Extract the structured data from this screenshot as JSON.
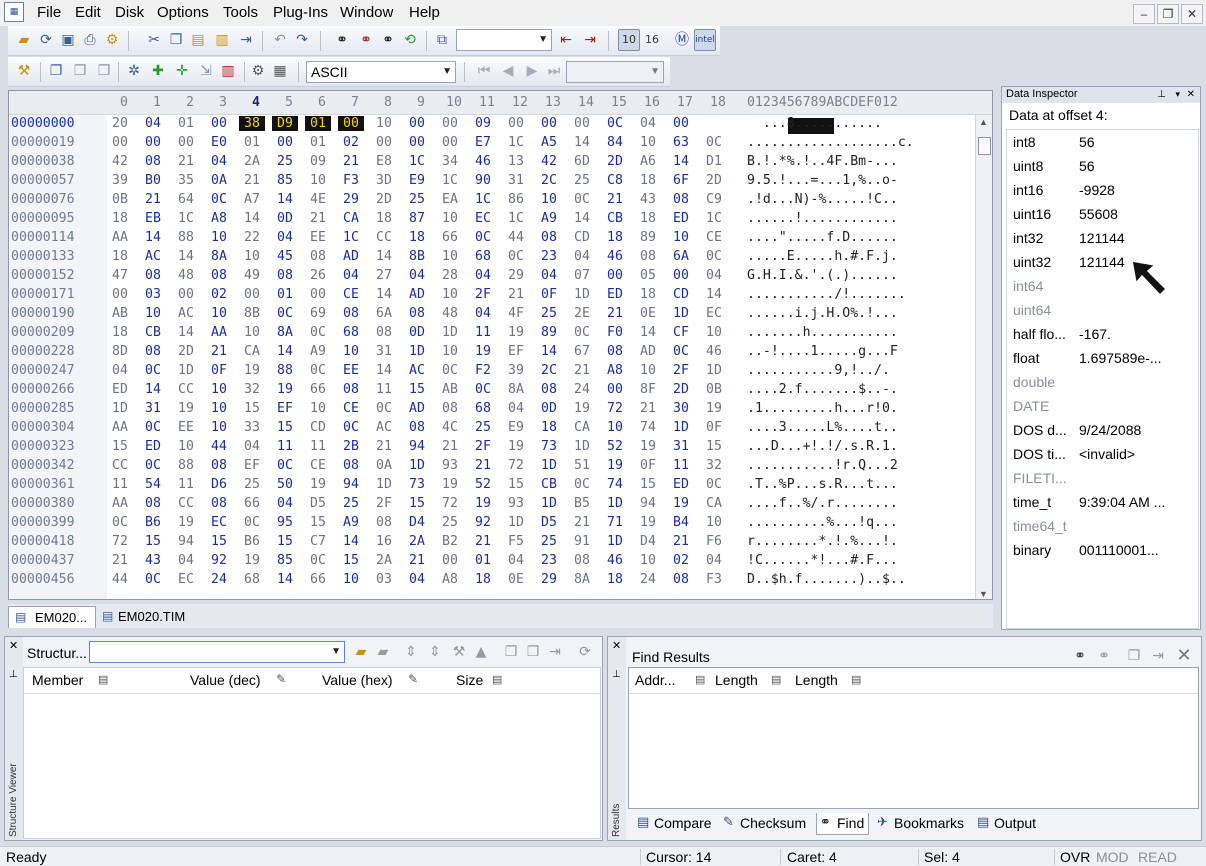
{
  "menu": [
    "File",
    "Edit",
    "Disk",
    "Options",
    "Tools",
    "Plug-Ins",
    "Window",
    "Help"
  ],
  "window_buttons": {
    "minimize": "–",
    "restore": "❐",
    "close": "✕"
  },
  "toolbar": {
    "encoding": "ASCII",
    "icons": [
      "open-icon",
      "reload-icon",
      "save-icon",
      "print-icon",
      "settings-icon",
      "cut-icon",
      "copy-icon",
      "paste-icon",
      "clipboard-icon",
      "export-icon",
      "undo-icon",
      "redo-icon",
      "find-icon",
      "find-prev-icon",
      "find-next-icon",
      "replace-icon",
      "goto-icon",
      "bookmark-prev-icon",
      "bookmark-next-icon",
      "hex-view-icon",
      "16-view-icon",
      "moto-icon",
      "intel-icon"
    ]
  },
  "hex": {
    "header_cols": [
      "0",
      "1",
      "2",
      "3",
      "4",
      "5",
      "6",
      "7",
      "8",
      "9",
      "10",
      "11",
      "12",
      "13",
      "14",
      "15",
      "16",
      "17",
      "18"
    ],
    "ascii_header": "0123456789ABCDEF012",
    "rows": [
      {
        "addr": "00000000",
        "bytes": [
          "20",
          "04",
          "01",
          "00",
          "38",
          "D9",
          "01",
          "00",
          "10",
          "00",
          "00",
          "09",
          "00",
          "00",
          "00",
          "0C",
          "04",
          "00"
        ],
        "ascii": "  ...8..........."
      },
      {
        "addr": "00000019",
        "bytes": [
          "00",
          "00",
          "00",
          "E0",
          "01",
          "00",
          "01",
          "02",
          "00",
          "00",
          "00",
          "E7",
          "1C",
          "A5",
          "14",
          "84",
          "10",
          "63",
          "0C"
        ],
        "ascii": "...................c."
      },
      {
        "addr": "00000038",
        "bytes": [
          "42",
          "08",
          "21",
          "04",
          "2A",
          "25",
          "09",
          "21",
          "E8",
          "1C",
          "34",
          "46",
          "13",
          "42",
          "6D",
          "2D",
          "A6",
          "14",
          "D1"
        ],
        "ascii": "B.!.*%.!..4F.Bm-..."
      },
      {
        "addr": "00000057",
        "bytes": [
          "39",
          "B0",
          "35",
          "0A",
          "21",
          "85",
          "10",
          "F3",
          "3D",
          "E9",
          "1C",
          "90",
          "31",
          "2C",
          "25",
          "C8",
          "18",
          "6F",
          "2D"
        ],
        "ascii": "9.5.!...=...1,%..o-"
      },
      {
        "addr": "00000076",
        "bytes": [
          "0B",
          "21",
          "64",
          "0C",
          "A7",
          "14",
          "4E",
          "29",
          "2D",
          "25",
          "EA",
          "1C",
          "86",
          "10",
          "0C",
          "21",
          "43",
          "08",
          "C9"
        ],
        "ascii": ".!d...N)-%.....!C.."
      },
      {
        "addr": "00000095",
        "bytes": [
          "18",
          "EB",
          "1C",
          "A8",
          "14",
          "0D",
          "21",
          "CA",
          "18",
          "87",
          "10",
          "EC",
          "1C",
          "A9",
          "14",
          "CB",
          "18",
          "ED",
          "1C"
        ],
        "ascii": "......!............"
      },
      {
        "addr": "00000114",
        "bytes": [
          "AA",
          "14",
          "88",
          "10",
          "22",
          "04",
          "EE",
          "1C",
          "CC",
          "18",
          "66",
          "0C",
          "44",
          "08",
          "CD",
          "18",
          "89",
          "10",
          "CE"
        ],
        "ascii": "....\".....f.D......"
      },
      {
        "addr": "00000133",
        "bytes": [
          "18",
          "AC",
          "14",
          "8A",
          "10",
          "45",
          "08",
          "AD",
          "14",
          "8B",
          "10",
          "68",
          "0C",
          "23",
          "04",
          "46",
          "08",
          "6A",
          "0C"
        ],
        "ascii": ".....E.....h.#.F.j."
      },
      {
        "addr": "00000152",
        "bytes": [
          "47",
          "08",
          "48",
          "08",
          "49",
          "08",
          "26",
          "04",
          "27",
          "04",
          "28",
          "04",
          "29",
          "04",
          "07",
          "00",
          "05",
          "00",
          "04"
        ],
        "ascii": "G.H.I.&.'.(.)......"
      },
      {
        "addr": "00000171",
        "bytes": [
          "00",
          "03",
          "00",
          "02",
          "00",
          "01",
          "00",
          "CE",
          "14",
          "AD",
          "10",
          "2F",
          "21",
          "0F",
          "1D",
          "ED",
          "18",
          "CD",
          "14"
        ],
        "ascii": ".........../!......."
      },
      {
        "addr": "00000190",
        "bytes": [
          "AB",
          "10",
          "AC",
          "10",
          "8B",
          "0C",
          "69",
          "08",
          "6A",
          "08",
          "48",
          "04",
          "4F",
          "25",
          "2E",
          "21",
          "0E",
          "1D",
          "EC"
        ],
        "ascii": "......i.j.H.O%.!..."
      },
      {
        "addr": "00000209",
        "bytes": [
          "18",
          "CB",
          "14",
          "AA",
          "10",
          "8A",
          "0C",
          "68",
          "08",
          "0D",
          "1D",
          "11",
          "19",
          "89",
          "0C",
          "F0",
          "14",
          "CF",
          "10"
        ],
        "ascii": ".......h..........."
      },
      {
        "addr": "00000228",
        "bytes": [
          "8D",
          "08",
          "2D",
          "21",
          "CA",
          "14",
          "A9",
          "10",
          "31",
          "1D",
          "10",
          "19",
          "EF",
          "14",
          "67",
          "08",
          "AD",
          "0C",
          "46"
        ],
        "ascii": "..-!....1.....g...F"
      },
      {
        "addr": "00000247",
        "bytes": [
          "04",
          "0C",
          "1D",
          "0F",
          "19",
          "88",
          "0C",
          "EE",
          "14",
          "AC",
          "0C",
          "F2",
          "39",
          "2C",
          "21",
          "A8",
          "10",
          "2F",
          "1D"
        ],
        "ascii": "...........9,!../."
      },
      {
        "addr": "00000266",
        "bytes": [
          "ED",
          "14",
          "CC",
          "10",
          "32",
          "19",
          "66",
          "08",
          "11",
          "15",
          "AB",
          "0C",
          "8A",
          "08",
          "24",
          "00",
          "8F",
          "2D",
          "0B"
        ],
        "ascii": "....2.f.......$..-."
      },
      {
        "addr": "00000285",
        "bytes": [
          "1D",
          "31",
          "19",
          "10",
          "15",
          "EF",
          "10",
          "CE",
          "0C",
          "AD",
          "08",
          "68",
          "04",
          "0D",
          "19",
          "72",
          "21",
          "30",
          "19"
        ],
        "ascii": ".1.........h...r!0."
      },
      {
        "addr": "00000304",
        "bytes": [
          "AA",
          "0C",
          "EE",
          "10",
          "33",
          "15",
          "CD",
          "0C",
          "AC",
          "08",
          "4C",
          "25",
          "E9",
          "18",
          "CA",
          "10",
          "74",
          "1D",
          "0F"
        ],
        "ascii": "....3.....L%....t.."
      },
      {
        "addr": "00000323",
        "bytes": [
          "15",
          "ED",
          "10",
          "44",
          "04",
          "11",
          "11",
          "2B",
          "21",
          "94",
          "21",
          "2F",
          "19",
          "73",
          "1D",
          "52",
          "19",
          "31",
          "15"
        ],
        "ascii": "...D...+!.!/.s.R.1."
      },
      {
        "addr": "00000342",
        "bytes": [
          "CC",
          "0C",
          "88",
          "08",
          "EF",
          "0C",
          "CE",
          "08",
          "0A",
          "1D",
          "93",
          "21",
          "72",
          "1D",
          "51",
          "19",
          "0F",
          "11",
          "32"
        ],
        "ascii": "...........!r.Q...2"
      },
      {
        "addr": "00000361",
        "bytes": [
          "11",
          "54",
          "11",
          "D6",
          "25",
          "50",
          "19",
          "94",
          "1D",
          "73",
          "19",
          "52",
          "15",
          "CB",
          "0C",
          "74",
          "15",
          "ED",
          "0C"
        ],
        "ascii": ".T..%P...s.R...t..."
      },
      {
        "addr": "00000380",
        "bytes": [
          "AA",
          "08",
          "CC",
          "08",
          "66",
          "04",
          "D5",
          "25",
          "2F",
          "15",
          "72",
          "19",
          "93",
          "1D",
          "B5",
          "1D",
          "94",
          "19",
          "CA"
        ],
        "ascii": "....f..%/.r........"
      },
      {
        "addr": "00000399",
        "bytes": [
          "0C",
          "B6",
          "19",
          "EC",
          "0C",
          "95",
          "15",
          "A9",
          "08",
          "D4",
          "25",
          "92",
          "1D",
          "D5",
          "21",
          "71",
          "19",
          "B4",
          "10"
        ],
        "ascii": "..........%...!q..."
      },
      {
        "addr": "00000418",
        "bytes": [
          "72",
          "15",
          "94",
          "15",
          "B6",
          "15",
          "C7",
          "14",
          "16",
          "2A",
          "B2",
          "21",
          "F5",
          "25",
          "91",
          "1D",
          "D4",
          "21",
          "F6"
        ],
        "ascii": "r........*.!.%...!."
      },
      {
        "addr": "00000437",
        "bytes": [
          "21",
          "43",
          "04",
          "92",
          "19",
          "85",
          "0C",
          "15",
          "2A",
          "21",
          "00",
          "01",
          "04",
          "23",
          "08",
          "46",
          "10",
          "02",
          "04"
        ],
        "ascii": "!C......*!...#.F..."
      },
      {
        "addr": "00000456",
        "bytes": [
          "44",
          "0C",
          "EC",
          "24",
          "68",
          "14",
          "66",
          "10",
          "03",
          "04",
          "A8",
          "18",
          "0E",
          "29",
          "8A",
          "18",
          "24",
          "08",
          "F3"
        ],
        "ascii": "D..$h.f.......)..$.."
      }
    ]
  },
  "doc_tabs": [
    "EM020...",
    "EM020.TIM"
  ],
  "inspector": {
    "title": "Data Inspector",
    "offset_label": "Data at offset 4:",
    "rows": [
      {
        "name": "int8",
        "value": "56",
        "enabled": true
      },
      {
        "name": "uint8",
        "value": "56",
        "enabled": true
      },
      {
        "name": "int16",
        "value": "-9928",
        "enabled": true
      },
      {
        "name": "uint16",
        "value": "55608",
        "enabled": true
      },
      {
        "name": "int32",
        "value": "121144",
        "enabled": true
      },
      {
        "name": "uint32",
        "value": "121144",
        "enabled": true
      },
      {
        "name": "int64",
        "value": "",
        "enabled": false
      },
      {
        "name": "uint64",
        "value": "",
        "enabled": false
      },
      {
        "name": "half flo...",
        "value": "-167.",
        "enabled": true
      },
      {
        "name": "float",
        "value": "1.697589e-...",
        "enabled": true
      },
      {
        "name": "double",
        "value": "",
        "enabled": false
      },
      {
        "name": "DATE",
        "value": "",
        "enabled": false
      },
      {
        "name": "DOS d...",
        "value": "9/24/2088",
        "enabled": true
      },
      {
        "name": "DOS ti...",
        "value": "<invalid>",
        "enabled": true
      },
      {
        "name": "FILETI...",
        "value": "",
        "enabled": false
      },
      {
        "name": "time_t",
        "value": "9:39:04 AM ...",
        "enabled": true
      },
      {
        "name": "time64_t",
        "value": "",
        "enabled": false
      },
      {
        "name": "binary",
        "value": "001110001...",
        "enabled": true
      }
    ]
  },
  "structure": {
    "side_label": "Structure Viewer",
    "combo_label": "Structur...",
    "columns": [
      "Member",
      "Value (dec)",
      "Value (hex)",
      "Size"
    ]
  },
  "find": {
    "side_label": "Results",
    "title": "Find Results",
    "columns": [
      "Addr...",
      "Length",
      "Length"
    ],
    "tabs": [
      "Compare",
      "Checksum",
      "Find",
      "Bookmarks",
      "Output"
    ]
  },
  "status": {
    "ready": "Ready",
    "cursor": "Cursor: 14",
    "caret": "Caret: 4",
    "sel": "Sel: 4",
    "ovr": "OVR",
    "mod": "MOD",
    "read": "READ"
  }
}
